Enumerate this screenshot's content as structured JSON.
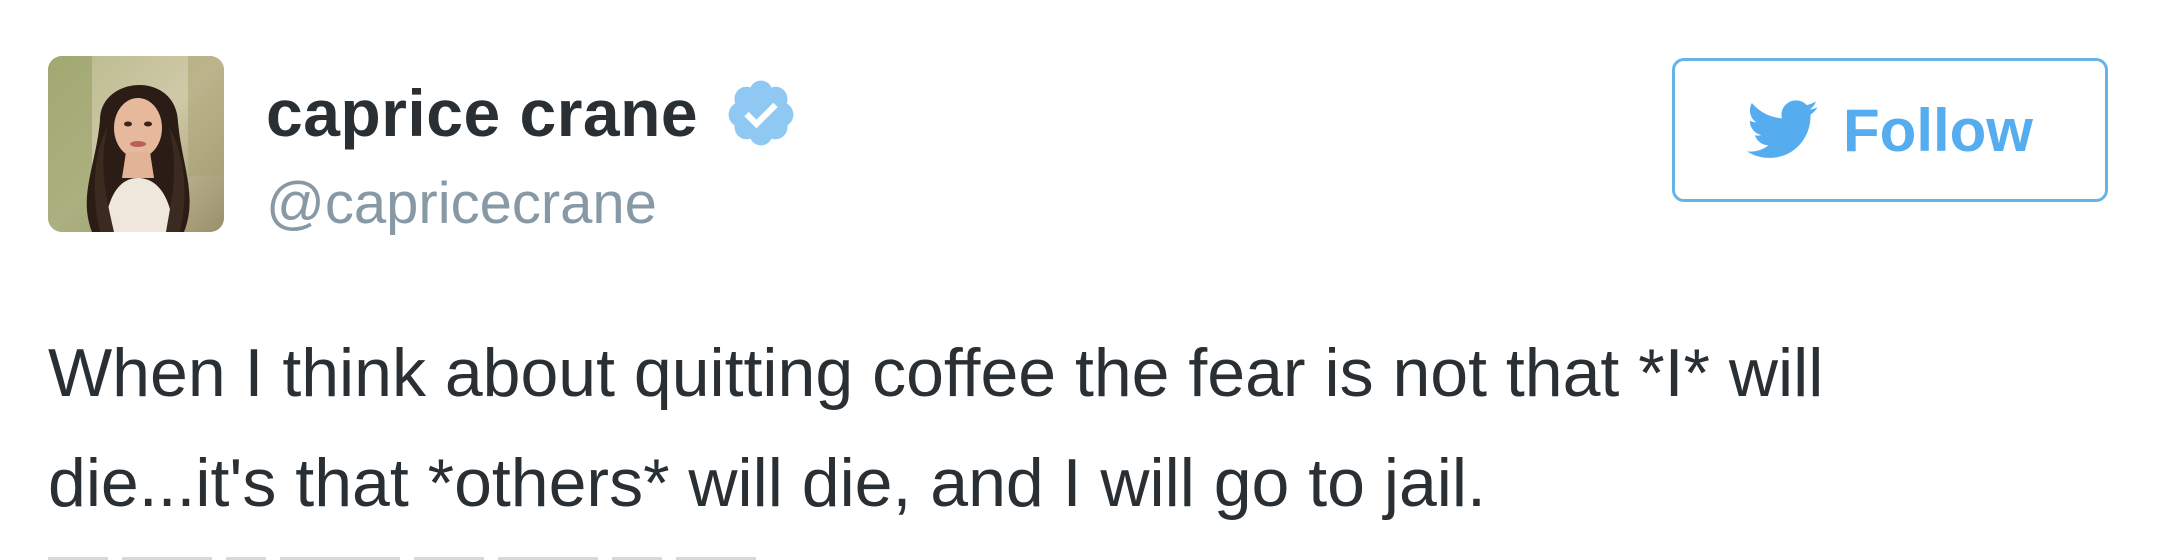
{
  "tweet": {
    "author": {
      "display_name": "caprice crane",
      "screen_name": "@capricecrane",
      "verified": true,
      "avatar_alt": "caprice crane avatar"
    },
    "follow_button": {
      "label": "Follow",
      "icon": "twitter-bird-icon"
    },
    "text": "When I think about quitting coffee the fear is not that *I* will\ndie...it's that *others* will die, and I will go to jail."
  },
  "colors": {
    "text_primary": "#292f33",
    "text_secondary": "#8899a6",
    "twitter_blue": "#55acee",
    "verified_blue": "#8ec8f3",
    "button_border": "#66b3e6"
  },
  "icons": {
    "verified": "verified-badge-icon",
    "bird": "twitter-bird-icon"
  }
}
